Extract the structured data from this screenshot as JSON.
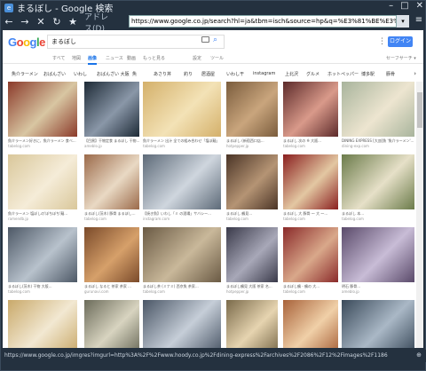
{
  "window": {
    "title": "まるぼし - Google 検索"
  },
  "toolbar": {
    "address_label": "アドレス(D)",
    "url": "https://www.google.co.jp/search?hl=ja&tbm=isch&source=hp&q=%E3%81%BE%E3%82%8B%E3%81%BC%E3%81%97%E3%83%A9"
  },
  "google": {
    "logo": "Google",
    "query": "まるぼし",
    "login": "ログイン"
  },
  "tabs": [
    {
      "label": "すべて"
    },
    {
      "label": "地図"
    },
    {
      "label": "画像",
      "active": true
    },
    {
      "label": "ニュース"
    },
    {
      "label": "動画"
    },
    {
      "label": "もっと見る"
    },
    {
      "label": "設定"
    },
    {
      "label": "ツール"
    },
    {
      "label": "セーフサーチ ▾"
    }
  ],
  "chips": [
    "魚介ラーメン",
    "おばんざい",
    "いわし",
    "おばんざい 大阪",
    "魚",
    "あさり丼",
    "釣り",
    "居酒屋",
    "いわし干",
    "instagram",
    "上北沢",
    "グルメ",
    "ホットペッパー",
    "博多駅",
    "豚骨"
  ],
  "results": [
    {
      "cap": "魚介ラーメン好きに、魚介ラーメン 食べ...",
      "src": "tabelog.com",
      "c1": "#8b3a2a",
      "c2": "#d8c6a2"
    },
    {
      "cap": "【目黒】干物定食 まるぼし 干物...",
      "src": "ameblo.jp",
      "c1": "#1d2a36",
      "c2": "#8a97a8"
    },
    {
      "cap": "魚介ラーメン 出汁 全ての組み合わせ「塩ぼ麺」",
      "src": "tabelog.com",
      "c1": "#d4b06a",
      "c2": "#f3e2b6"
    },
    {
      "cap": "まるぼし (新宿西口店...",
      "src": "hotpepper.jp",
      "c1": "#7a5c3c",
      "c2": "#c9a57d"
    },
    {
      "cap": "まるぼし 次の ※ 大阪...",
      "src": "tabelog.com",
      "c1": "#5c2a2a",
      "c2": "#d99a8a"
    },
    {
      "cap": "DINING EXPRESS [大皿]魚 '魚介ラーメン'...",
      "src": "dining-exp.com",
      "c1": "#a8b49c",
      "c2": "#ede5d0"
    },
    {
      "cap": "魚介ラーメン 塩ぼしの'ぼちぼち'麺...",
      "src": "ramendb.jp",
      "c1": "#d9c79a",
      "c2": "#f5ecd8"
    },
    {
      "cap": "まるぼし(茨木) 豚骨 まるぼし...",
      "src": "tabelog.com",
      "c1": "#9b6a4a",
      "c2": "#e9d9c4"
    },
    {
      "cap": "【焼き魚】いわし「ミ の酒場」サバシー...",
      "src": "instagram.com",
      "c1": "#5d6a78",
      "c2": "#cfd6de"
    },
    {
      "cap": "まるぼし 鶴見...",
      "src": "tabelog.com",
      "c1": "#4a3426",
      "c2": "#b59474"
    },
    {
      "cap": "まるぼし 大 豚骨 ～ 大 ～...",
      "src": "tabelog.com",
      "c1": "#8a1f1f",
      "c2": "#e3c7a2"
    },
    {
      "cap": "まるぼし 本...",
      "src": "tabelog.com",
      "c1": "#6b7b4a",
      "c2": "#e6e0c8"
    },
    {
      "cap": "まるぼし(茨木) 干物 大阪...",
      "src": "tabelog.com",
      "c1": "#4d5866",
      "c2": "#b8c2cc"
    },
    {
      "cap": "まるぼし なると 茶家 茶家 ...",
      "src": "gurunavi.com",
      "c1": "#7a4a2a",
      "c2": "#d6a06a"
    },
    {
      "cap": "まるぼし茶 (ミナミ) 西京魚 茶家...",
      "src": "tabelog.com",
      "c1": "#6a5a44",
      "c2": "#c9b89a"
    },
    {
      "cap": "まるぼし鶴見 大阪 茶家 名...",
      "src": "hotpepper.jp",
      "c1": "#3a3a4a",
      "c2": "#a8a8b8"
    },
    {
      "cap": "まるぼし鶴 - 鶴の 大...",
      "src": "tabelog.com",
      "c1": "#8a2a2a",
      "c2": "#d9a88a"
    },
    {
      "cap": "明石 豚骨...",
      "src": "ameblo.jp",
      "c1": "#5a4a6a",
      "c2": "#c8bcd6"
    },
    {
      "cap": "",
      "src": "",
      "c1": "#c9a96a",
      "c2": "#f2e8d2"
    },
    {
      "cap": "",
      "src": "",
      "c1": "#6b6b5a",
      "c2": "#d8d4c0"
    },
    {
      "cap": "",
      "src": "",
      "c1": "#4a5666",
      "c2": "#c6ced8"
    },
    {
      "cap": "",
      "src": "",
      "c1": "#7a6a4a",
      "c2": "#e6d4b0"
    },
    {
      "cap": "",
      "src": "",
      "c1": "#a8623a",
      "c2": "#f0d0a8"
    },
    {
      "cap": "",
      "src": "",
      "c1": "#3a4a5a",
      "c2": "#aab8c6"
    }
  ],
  "status": {
    "text": "https://www.google.co.jp/imgres?imgurl=http%3A%2F%2Fwww.hoody.co.jp%2Fdining-express%2Farchives%2F2086%2F12%2Fimages%2F1186"
  }
}
